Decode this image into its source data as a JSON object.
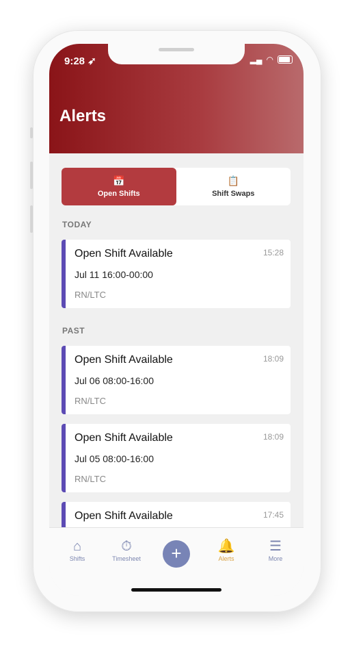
{
  "status": {
    "time": "9:28"
  },
  "header": {
    "title": "Alerts"
  },
  "segments": [
    {
      "label": "Open Shifts",
      "icon": "calendar-check-icon",
      "active": true
    },
    {
      "label": "Shift Swaps",
      "icon": "clipboard-icon",
      "active": false
    }
  ],
  "sections": {
    "today": "TODAY",
    "past": "PAST"
  },
  "alerts": [
    {
      "title": "Open Shift Available",
      "time": "15:28",
      "date": "Jul 11 16:00-00:00",
      "role": "RN/LTC"
    },
    {
      "title": "Open Shift Available",
      "time": "18:09",
      "date": "Jul 06 08:00-16:00",
      "role": "RN/LTC"
    },
    {
      "title": "Open Shift Available",
      "time": "18:09",
      "date": "Jul 05 08:00-16:00",
      "role": "RN/LTC"
    },
    {
      "title": "Open Shift Available",
      "time": "17:45"
    }
  ],
  "tabs": [
    {
      "label": "Shifts",
      "icon": "home-icon"
    },
    {
      "label": "Timesheet",
      "icon": "stopwatch-icon"
    },
    {
      "label": "",
      "icon": "plus-icon"
    },
    {
      "label": "Alerts",
      "icon": "bell-icon",
      "active": true
    },
    {
      "label": "More",
      "icon": "menu-icon"
    }
  ],
  "colors": {
    "header": "#8a1418",
    "accent": "#b33b3f",
    "card_border": "#5c4bb4",
    "active_tab": "#d8a040"
  }
}
